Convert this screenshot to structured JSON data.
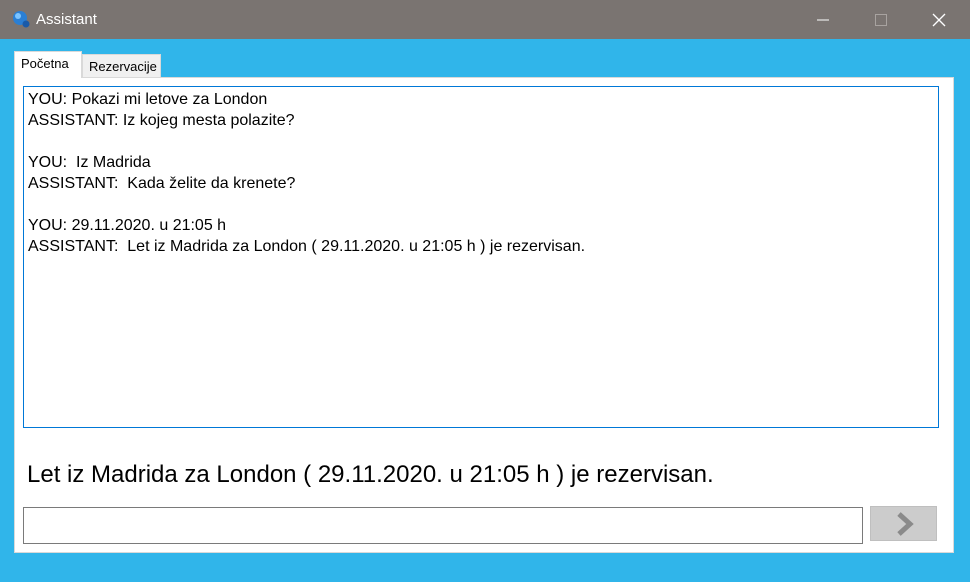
{
  "window": {
    "title": "Assistant"
  },
  "tabs": [
    {
      "label": "Početna",
      "active": true
    },
    {
      "label": "Rezervacije",
      "active": false
    }
  ],
  "chat": {
    "lines": [
      "YOU: Pokazi mi letove za London",
      "ASSISTANT: Iz kojeg mesta polazite?",
      "",
      "YOU:  Iz Madrida",
      "ASSISTANT:  Kada želite da krenete?",
      "",
      "YOU: 29.11.2020. u 21:05 h",
      "ASSISTANT:  Let iz Madrida za London ( 29.11.2020. u 21:05 h ) je rezervisan."
    ]
  },
  "result_text": "Let iz Madrida za London ( 29.11.2020. u 21:05 h ) je rezervisan.",
  "input": {
    "value": "",
    "placeholder": ""
  },
  "icons": {
    "app": "assistant-logo-icon",
    "minimize": "minimize-icon",
    "maximize": "maximize-icon",
    "close": "close-icon",
    "send": "chevron-right-icon"
  },
  "colors": {
    "titlebar": "#7a7471",
    "frame": "#30b5ea",
    "chat_border": "#0078d7",
    "send_button": "#cccccc"
  }
}
